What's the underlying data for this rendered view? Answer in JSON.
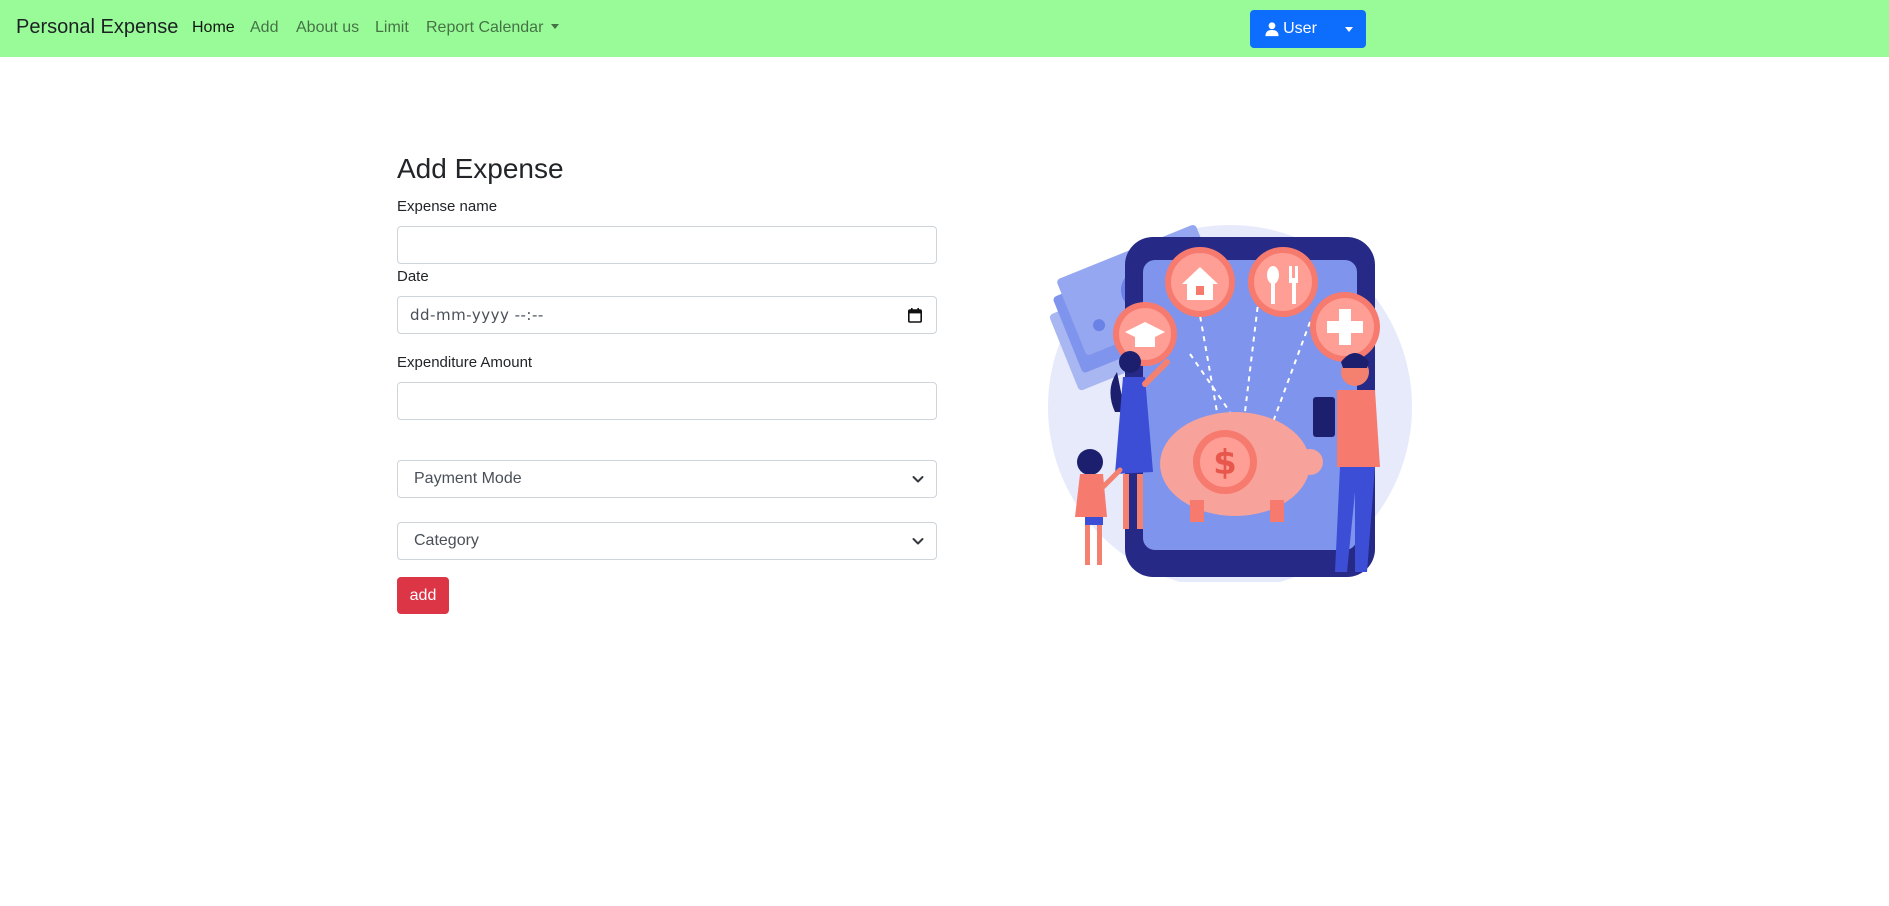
{
  "nav": {
    "brand": "Personal Expense",
    "links": [
      {
        "label": "Home"
      },
      {
        "label": "Add"
      },
      {
        "label": "About us"
      },
      {
        "label": "Limit"
      },
      {
        "label": "Report Calendar"
      }
    ],
    "user_label": "User",
    "bg_color": "#98fb98"
  },
  "form": {
    "title": "Add Expense",
    "expense_name_label": "Expense name",
    "expense_name_value": "",
    "date_label": "Date",
    "date_placeholder": "dd-mm-yyyy --:--",
    "amount_label": "Expenditure Amount",
    "amount_value": "",
    "payment_mode_selected": "Payment Mode",
    "category_selected": "Category",
    "add_label": "add"
  },
  "colors": {
    "primary": "#0d6efd",
    "danger": "#dc3545"
  },
  "icons": [
    "user-icon",
    "caret-down-icon",
    "calendar-icon",
    "chevron-down-icon"
  ]
}
